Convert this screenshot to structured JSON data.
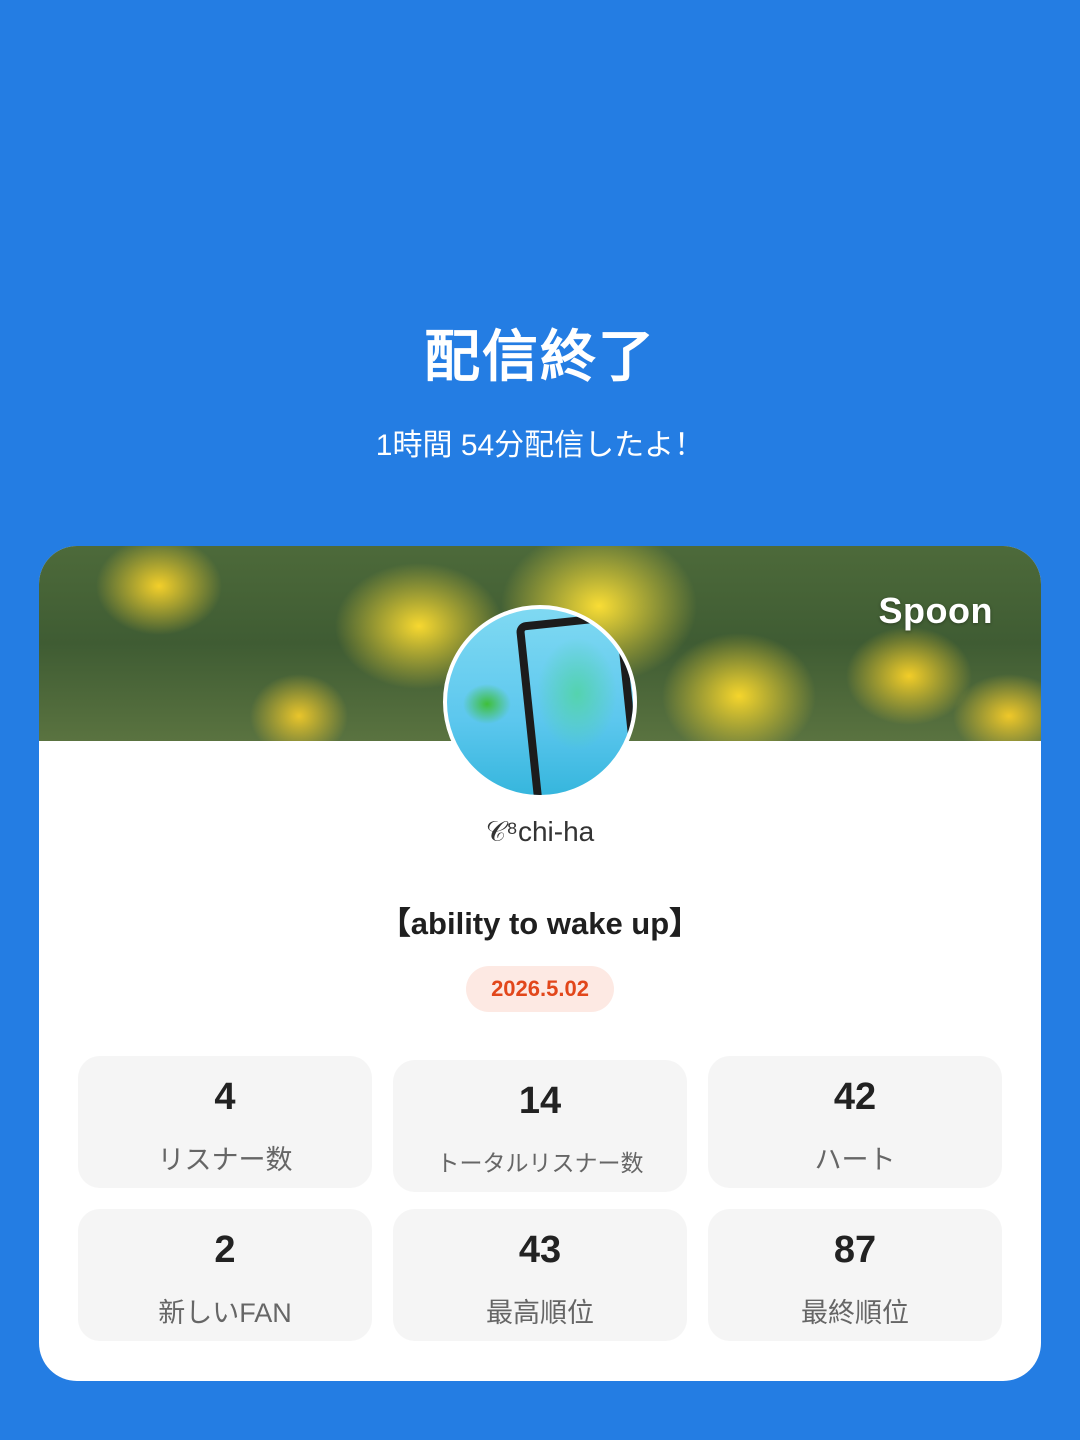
{
  "header": {
    "title": "配信終了",
    "subtitle": "1時間 54分配信したよ！"
  },
  "card": {
    "logo": "Spoon",
    "username": "𝒞⁸chi-ha",
    "broadcast_title": "【ability to wake up】",
    "date": "2026.5.02"
  },
  "stats": [
    {
      "value": "4",
      "label": "リスナー数"
    },
    {
      "value": "14",
      "label": "トータルリスナー数"
    },
    {
      "value": "42",
      "label": "ハート"
    },
    {
      "value": "2",
      "label": "新しいFAN"
    },
    {
      "value": "43",
      "label": "最高順位"
    },
    {
      "value": "87",
      "label": "最終順位"
    }
  ],
  "colors": {
    "background": "#247de3",
    "date_badge_text": "#e2471b",
    "date_badge_bg": "#fde9e3"
  }
}
